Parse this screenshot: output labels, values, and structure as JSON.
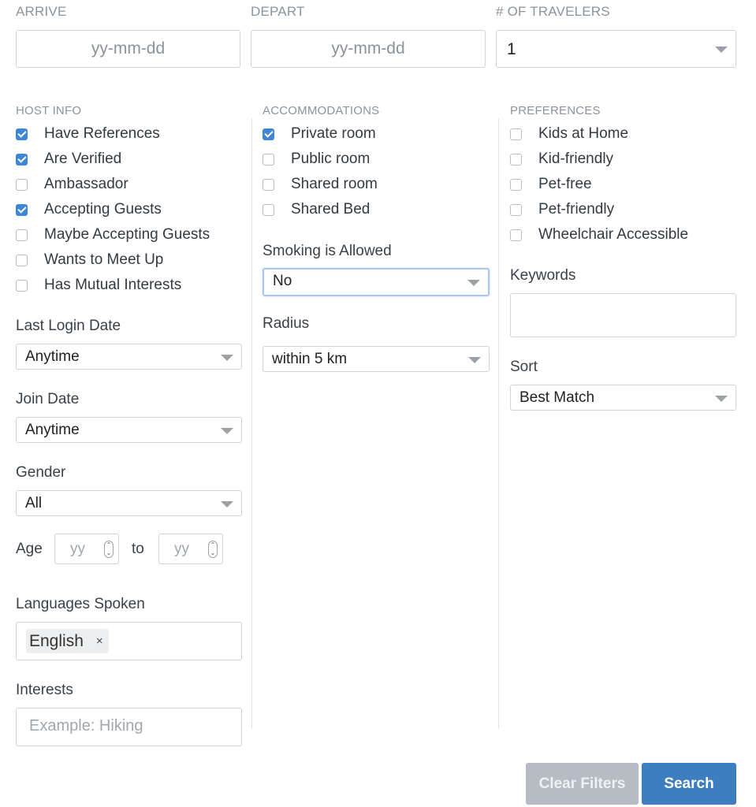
{
  "top": {
    "arrive_label": "ARRIVE",
    "arrive_placeholder": "yy-mm-dd",
    "depart_label": "DEPART",
    "depart_placeholder": "yy-mm-dd",
    "travelers_label": "# OF TRAVELERS",
    "travelers_value": "1"
  },
  "host_info": {
    "heading": "HOST INFO",
    "items": [
      {
        "label": "Have References",
        "checked": true
      },
      {
        "label": "Are Verified",
        "checked": true
      },
      {
        "label": "Ambassador",
        "checked": false
      },
      {
        "label": "Accepting Guests",
        "checked": true
      },
      {
        "label": "Maybe Accepting Guests",
        "checked": false
      },
      {
        "label": "Wants to Meet Up",
        "checked": false
      },
      {
        "label": "Has Mutual Interests",
        "checked": false
      }
    ],
    "last_login_label": "Last Login Date",
    "last_login_value": "Anytime",
    "join_date_label": "Join Date",
    "join_date_value": "Anytime",
    "gender_label": "Gender",
    "gender_value": "All",
    "age_label": "Age",
    "age_from_placeholder": "yy",
    "age_to_label": "to",
    "age_to_placeholder": "yy",
    "languages_label": "Languages Spoken",
    "languages": [
      "English"
    ],
    "tag_remove_glyph": "×",
    "interests_label": "Interests",
    "interests_placeholder": "Example: Hiking"
  },
  "accommodations": {
    "heading": "ACCOMMODATIONS",
    "items": [
      {
        "label": "Private room",
        "checked": true
      },
      {
        "label": "Public room",
        "checked": false
      },
      {
        "label": "Shared room",
        "checked": false
      },
      {
        "label": "Shared Bed",
        "checked": false
      }
    ],
    "smoking_label": "Smoking is Allowed",
    "smoking_value": "No",
    "radius_label": "Radius",
    "radius_value": "within 5 km"
  },
  "preferences": {
    "heading": "PREFERENCES",
    "items": [
      {
        "label": "Kids at Home",
        "checked": false
      },
      {
        "label": "Kid-friendly",
        "checked": false
      },
      {
        "label": "Pet-free",
        "checked": false
      },
      {
        "label": "Pet-friendly",
        "checked": false
      },
      {
        "label": "Wheelchair Accessible",
        "checked": false
      }
    ],
    "keywords_label": "Keywords",
    "keywords_value": "",
    "sort_label": "Sort",
    "sort_value": "Best Match"
  },
  "actions": {
    "clear_label": "Clear Filters",
    "search_label": "Search"
  },
  "colors": {
    "checkbox_checked": "#3f86d6",
    "search_button": "#3d7ebf",
    "clear_button": "#b6bcc4"
  }
}
